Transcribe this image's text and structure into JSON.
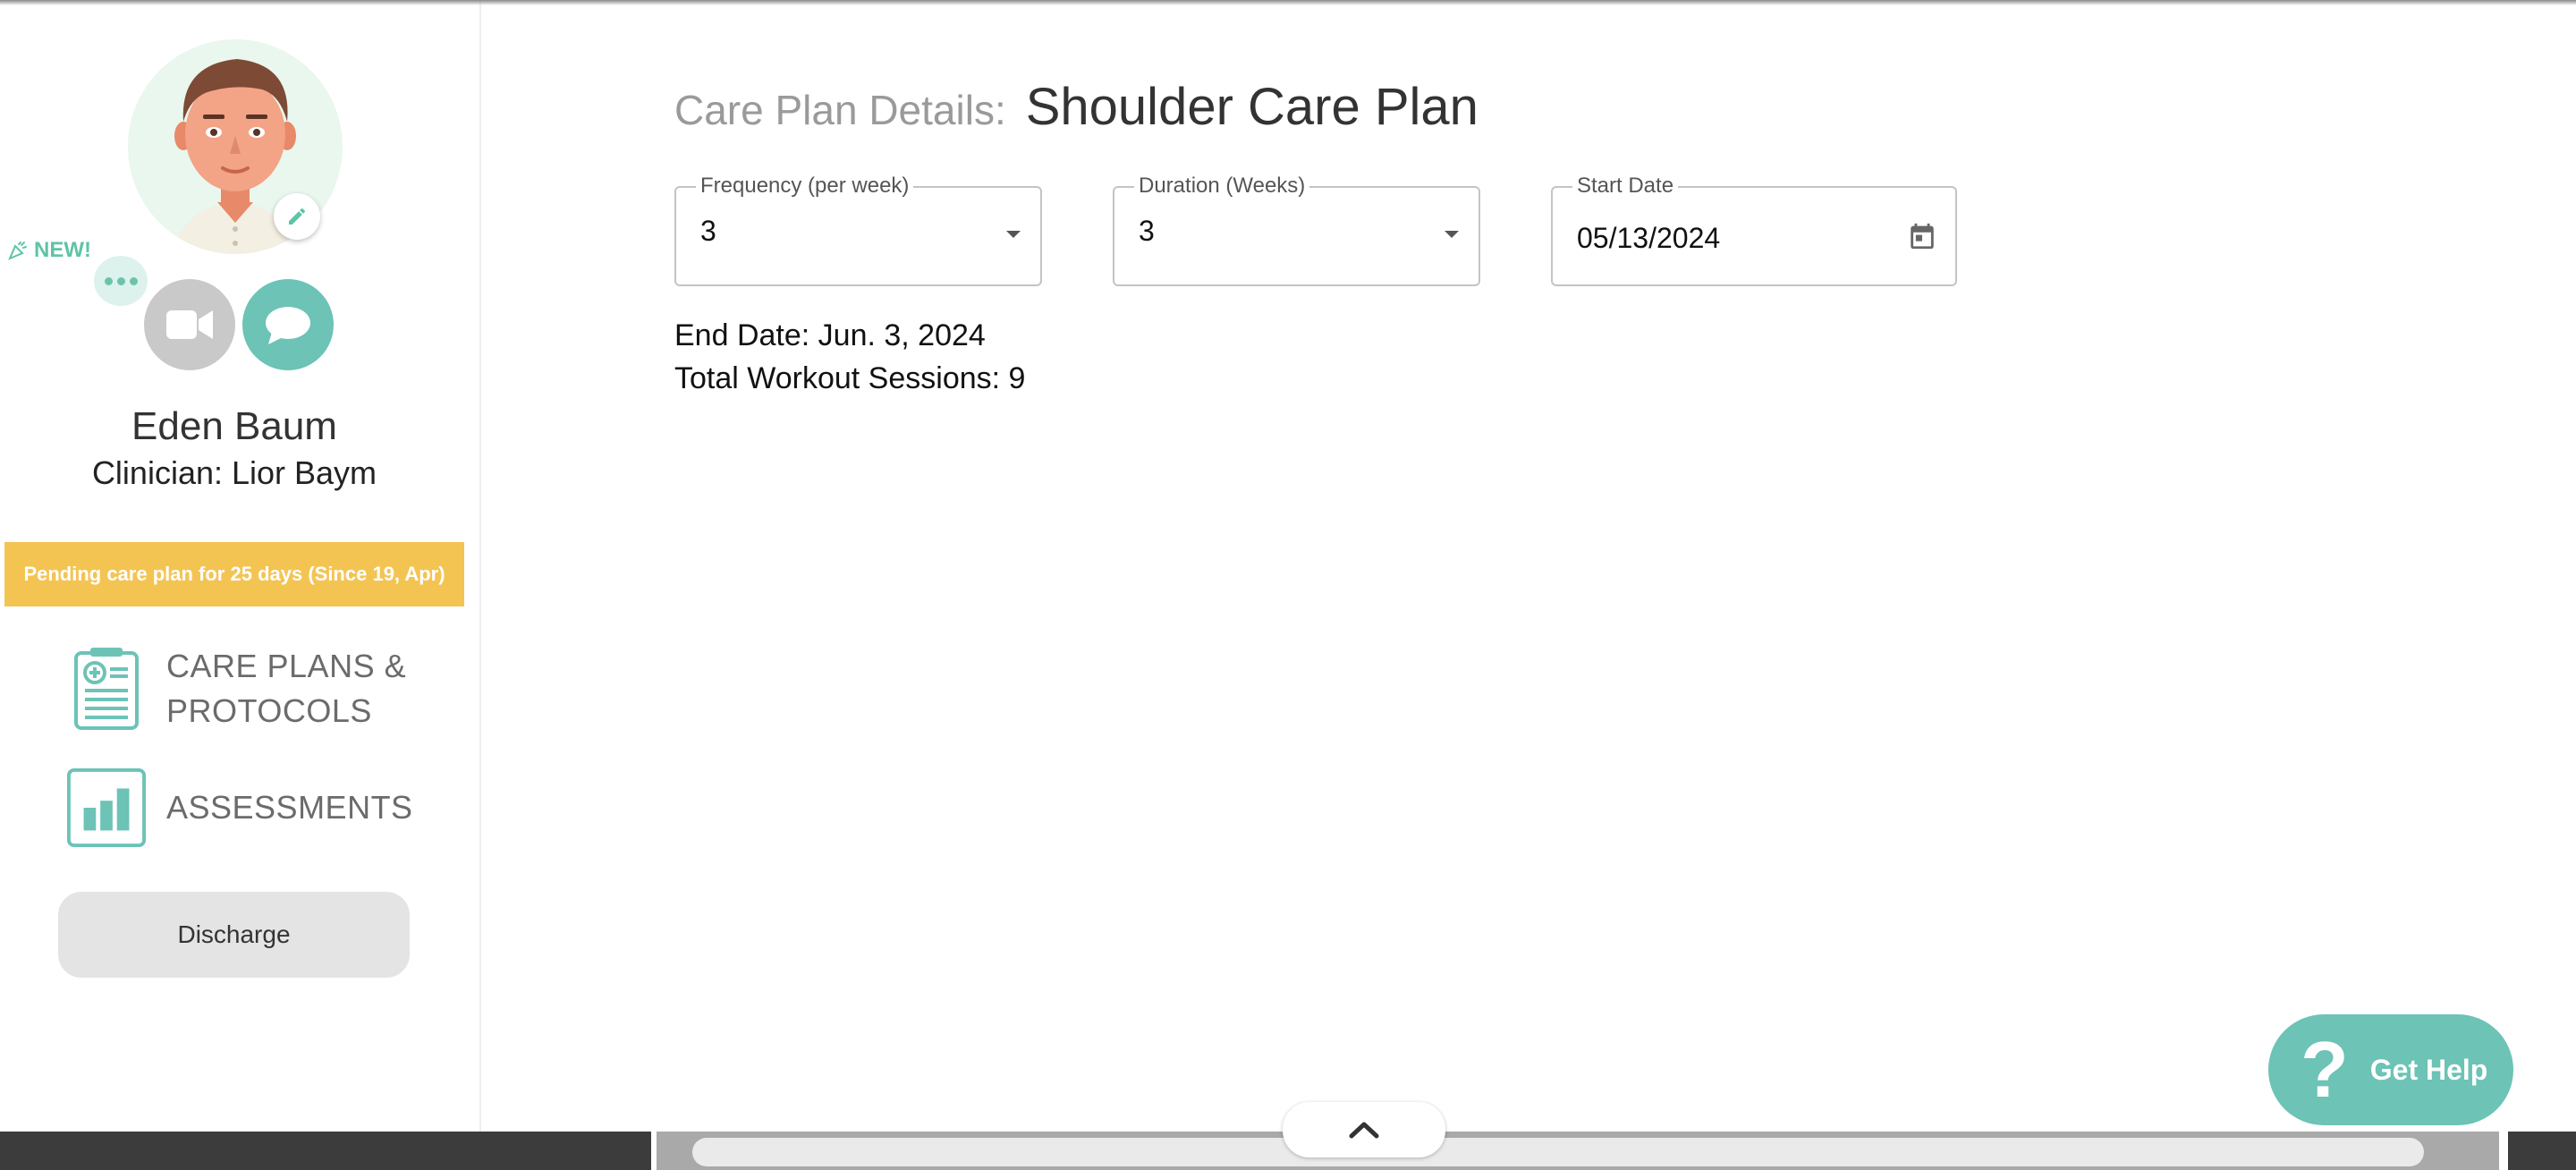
{
  "patient": {
    "name": "Eden Baum",
    "clinician": "Clinician: Lior Baym",
    "new_badge": "NEW!",
    "pending_banner": "Pending care plan for 25 days (Since 19, Apr)"
  },
  "nav": {
    "care_plans_line1": "CARE PLANS &",
    "care_plans_line2": "PROTOCOLS",
    "assessments": "ASSESSMENTS"
  },
  "discharge_label": "Discharge",
  "care_plan": {
    "title_prefix": "Care Plan Details:",
    "title": "Shoulder Care Plan",
    "frequency": {
      "label": "Frequency (per week)",
      "value": "3"
    },
    "duration": {
      "label": "Duration (Weeks)",
      "value": "3"
    },
    "start_date": {
      "label": "Start Date",
      "value": "05/13/2024"
    },
    "end_date": "End Date: Jun. 3, 2024",
    "total_sessions": "Total Workout Sessions: 9"
  },
  "help": {
    "label": "Get Help",
    "icon": "question-icon"
  },
  "colors": {
    "teal": "#6cc3b6",
    "banner": "#f4c453",
    "new": "#5ec4a6"
  }
}
